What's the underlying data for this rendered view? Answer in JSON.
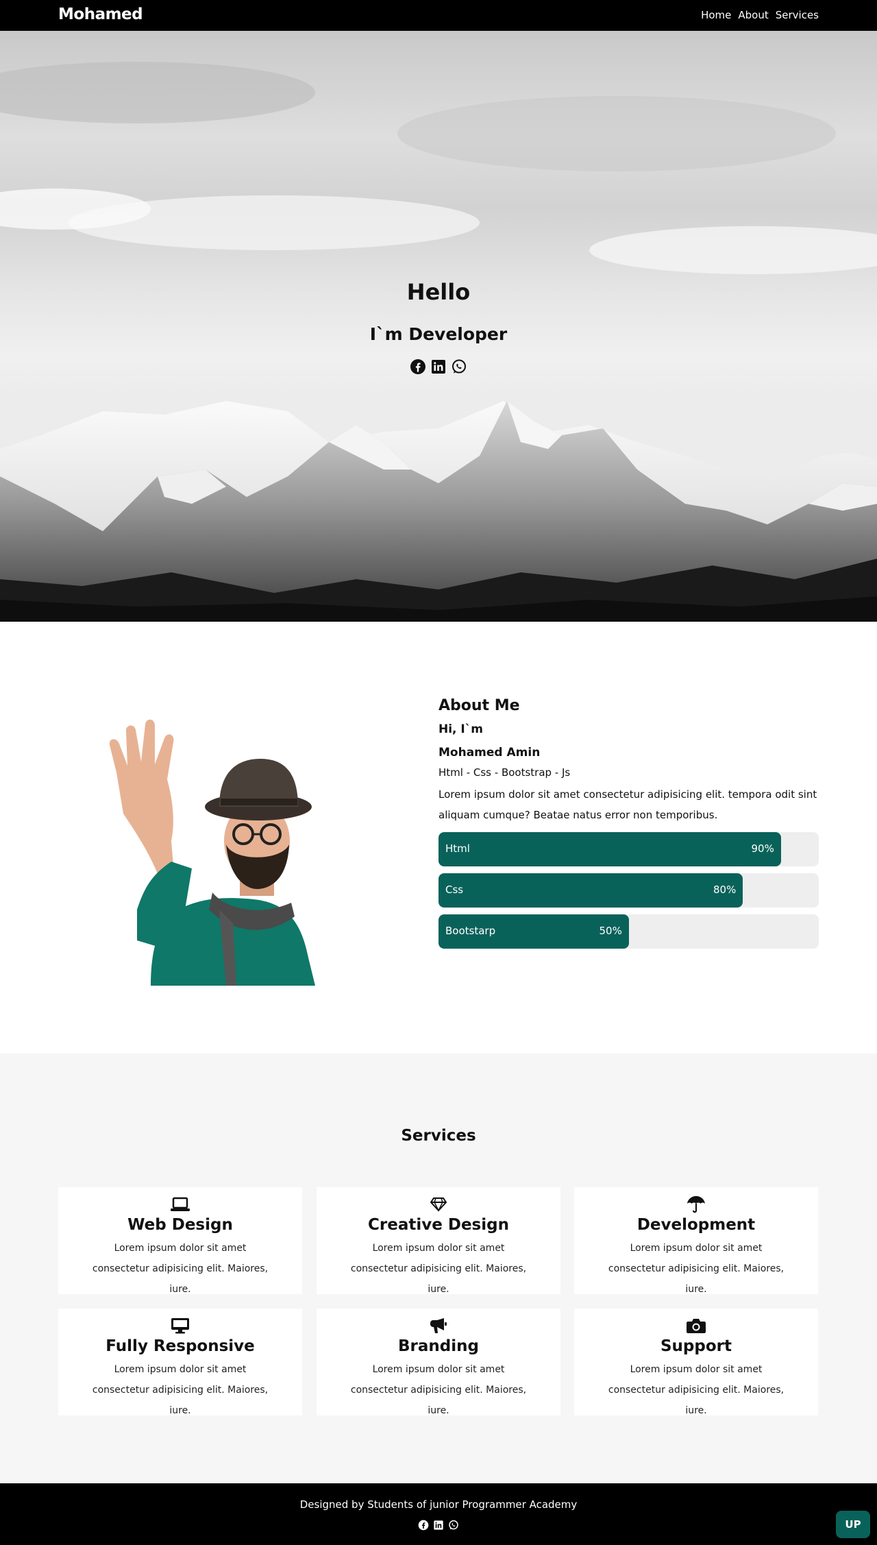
{
  "nav": {
    "brand": "Mohamed",
    "links": [
      "Home",
      "About",
      "Services"
    ]
  },
  "hero": {
    "title": "Hello",
    "subtitle": "I`m Developer",
    "social_icons": [
      "facebook-icon",
      "linkedin-icon",
      "whatsapp-icon"
    ]
  },
  "about": {
    "title": "About Me",
    "greeting": "Hi, I`m",
    "name": "Mohamed Amin",
    "skills_line": "Html - Css - Bootstrap - Js",
    "description": "Lorem ipsum dolor sit amet consectetur adipisicing elit. tempora odit sint aliquam cumque? Beatae natus error non temporibus.",
    "skills": [
      {
        "label": "Html",
        "percent_text": "90%",
        "percent": 90
      },
      {
        "label": "Css",
        "percent_text": "80%",
        "percent": 80
      },
      {
        "label": "Bootstarp",
        "percent_text": "50%",
        "percent": 50
      }
    ]
  },
  "services": {
    "title": "Services",
    "items": [
      {
        "icon": "laptop-icon",
        "title": "Web Design",
        "desc": "Lorem ipsum dolor sit amet consectetur adipisicing elit. Maiores, iure."
      },
      {
        "icon": "gem-icon",
        "title": "Creative Design",
        "desc": "Lorem ipsum dolor sit amet consectetur adipisicing elit. Maiores, iure."
      },
      {
        "icon": "umbrella-icon",
        "title": "Development",
        "desc": "Lorem ipsum dolor sit amet consectetur adipisicing elit. Maiores, iure."
      },
      {
        "icon": "desktop-icon",
        "title": "Fully Responsive",
        "desc": "Lorem ipsum dolor sit amet consectetur adipisicing elit. Maiores, iure."
      },
      {
        "icon": "bullhorn-icon",
        "title": "Branding",
        "desc": "Lorem ipsum dolor sit amet consectetur adipisicing elit. Maiores, iure."
      },
      {
        "icon": "camera-icon",
        "title": "Support",
        "desc": "Lorem ipsum dolor sit amet consectetur adipisicing elit. Maiores, iure."
      }
    ]
  },
  "footer": {
    "text": "Designed by Students of junior Programmer Academy",
    "up_label": "UP"
  },
  "colors": {
    "accent": "#09625a",
    "nav_bg": "#000000",
    "services_bg": "#f6f6f6",
    "bar_track": "#eeeeee"
  }
}
